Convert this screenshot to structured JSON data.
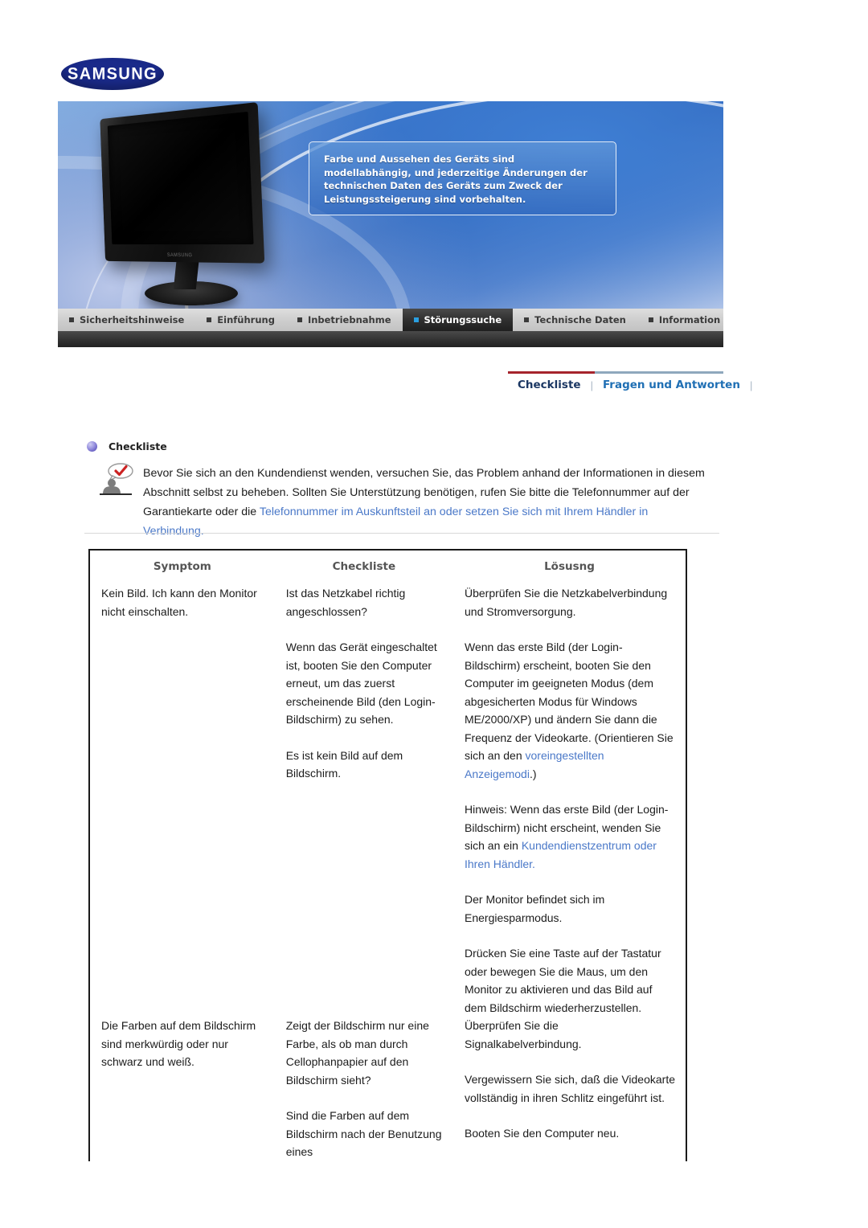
{
  "brand": {
    "logo_text": "SAMSUNG"
  },
  "banner": {
    "notice": "Farbe und Aussehen des Geräts sind modellabhängig, und jederzeitige Änderungen der technischen Daten des Geräts zum Zweck der Leistungssteigerung sind vorbehalten.",
    "monitor_brand": "SAMSUNG"
  },
  "nav": {
    "items": [
      {
        "label": "Sicherheitshinweise",
        "active": false
      },
      {
        "label": "Einführung",
        "active": false
      },
      {
        "label": "Inbetriebnahme",
        "active": false
      },
      {
        "label": "Störungssuche",
        "active": true
      },
      {
        "label": "Technische Daten",
        "active": false
      },
      {
        "label": "Information",
        "active": false
      }
    ]
  },
  "subnav": {
    "items": [
      {
        "label": "Checkliste",
        "active": true
      },
      {
        "label": "Fragen und Antworten",
        "active": false
      }
    ],
    "separator": "|",
    "accent_red": "#a6242c",
    "accent_blue": "#1f6fb4"
  },
  "section": {
    "bullet_icon": "sphere-bullet-icon",
    "title": "Checkliste",
    "intro_icon": "person-checkmark-icon",
    "intro_part1": "Bevor Sie sich an den Kundendienst wenden, versuchen Sie, das Problem anhand der Informationen in diesem Abschnitt selbst zu beheben. Sollten Sie Unterstützung benötigen, rufen Sie bitte die Telefonnummer auf der Garantiekarte oder die ",
    "intro_link": "Telefonnummer im Auskunftsteil an oder setzen Sie sich mit Ihrem Händler in Verbindung."
  },
  "table": {
    "headers": [
      "Symptom",
      "Checkliste",
      "Lösusng"
    ],
    "rows": [
      {
        "symptom": "Kein Bild. Ich kann den Monitor nicht einschalten.",
        "checks": [
          {
            "text": "Ist das Netzkabel richtig angeschlossen?"
          },
          {
            "text": "Wenn das Gerät eingeschaltet ist, booten Sie den Computer erneut, um das zuerst erscheinende Bild (den Login-Bildschirm) zu sehen."
          },
          {
            "text": "Es ist kein Bild auf dem Bildschirm."
          }
        ],
        "solutions": [
          {
            "text": "Überprüfen Sie die Netzkabelverbindung und Stromversorgung."
          },
          {
            "pre": "Wenn das erste Bild (der Login-Bildschirm) erscheint, booten Sie den Computer im geeigneten Modus (dem abgesicherten Modus für Windows ME/2000/XP) und ändern Sie dann die Frequenz der Videokarte. (Orientieren Sie sich an den ",
            "link": "voreingestellten Anzeigemodi",
            "post": ".)"
          },
          {
            "pre": "Hinweis: Wenn das erste Bild (der Login-Bildschirm) nicht erscheint, wenden Sie sich an ein ",
            "link": "Kundendienstzentrum oder Ihren Händler.",
            "post": ""
          },
          {
            "text": "Der Monitor befindet sich im Energiesparmodus."
          },
          {
            "text": "Drücken Sie eine Taste auf der Tastatur oder bewegen Sie die Maus, um den Monitor zu aktivieren und das Bild auf dem Bildschirm wiederherzustellen."
          }
        ]
      },
      {
        "symptom": "Die Farben auf dem Bildschirm sind merkwürdig oder nur schwarz und weiß.",
        "checks": [
          {
            "text": "Zeigt der Bildschirm nur eine Farbe, als ob man durch Cellophanpapier auf den Bildschirm sieht?"
          },
          {
            "text": "Sind die Farben auf dem Bildschirm nach der Benutzung eines"
          }
        ],
        "solutions": [
          {
            "text": "Überprüfen Sie die Signalkabelverbindung."
          },
          {
            "text": "Vergewissern Sie sich, daß die Videokarte vollständig in ihren Schlitz eingeführt ist."
          },
          {
            "text": "Booten Sie den Computer neu."
          }
        ]
      }
    ]
  }
}
